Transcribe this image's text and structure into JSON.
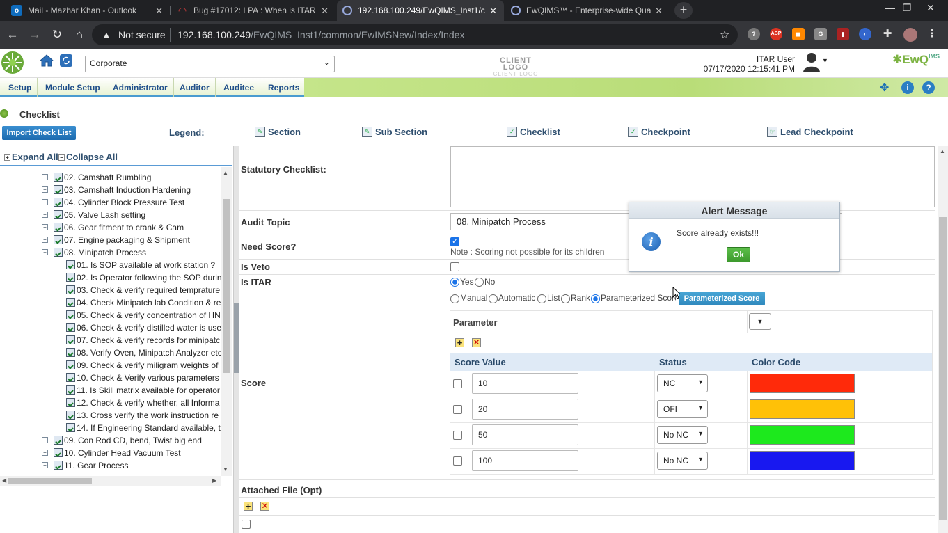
{
  "browser": {
    "tabs": [
      {
        "title": "Mail - Mazhar Khan - Outlook",
        "icon": "outlook-icon"
      },
      {
        "title": "Bug #17012: LPA : When is ITAR",
        "icon": "bug-tracker-icon"
      },
      {
        "title": "192.168.100.249/EwQIMS_Inst1/c",
        "icon": "globe-icon"
      },
      {
        "title": "EwQIMS™ - Enterprise-wide Qua",
        "icon": "globe-icon"
      }
    ],
    "not_secure": "Not secure",
    "url_host": "192.168.100.249",
    "url_path": "/EwQIMS_Inst1/common/EwIMSNew/Index/Index"
  },
  "header": {
    "entity_select": "Corporate",
    "client_logo": "CLIENT LOGO",
    "client_logo_sub": "CLIENT LOGO",
    "user_name": "ITAR User",
    "datetime": "07/17/2020 12:15:41 PM",
    "brand": "EwQ",
    "brand_sup": "IMS"
  },
  "menu": [
    "Setup",
    "Module Setup",
    "Administrator",
    "Auditor",
    "Auditee",
    "Reports"
  ],
  "breadcrumb": "Checklist",
  "legend": {
    "import_button": "Import Check List",
    "label": "Legend:",
    "items": [
      "Section",
      "Sub Section",
      "Checklist",
      "Checkpoint",
      "Lead Checkpoint"
    ]
  },
  "tree": {
    "expand_all": "Expand All",
    "collapse_all": "Collapse All",
    "items": [
      {
        "label": "02. Camshaft Rumbling",
        "level": 1,
        "exp": "+"
      },
      {
        "label": "03. Camshaft Induction Hardening",
        "level": 1,
        "exp": "+"
      },
      {
        "label": "04. Cylinder Block Pressure Test",
        "level": 1,
        "exp": "+"
      },
      {
        "label": "05. Valve Lash setting",
        "level": 1,
        "exp": "+"
      },
      {
        "label": "06. Gear fitment to crank & Cam",
        "level": 1,
        "exp": "+"
      },
      {
        "label": "07. Engine packaging & Shipment",
        "level": 1,
        "exp": "+"
      },
      {
        "label": "08. Minipatch Process",
        "level": 1,
        "exp": "-"
      },
      {
        "label": "01. Is SOP available at work station ?",
        "level": 2,
        "exp": ""
      },
      {
        "label": "02. Is Operator following the SOP durin",
        "level": 2,
        "exp": ""
      },
      {
        "label": "03. Check & verify required temprature",
        "level": 2,
        "exp": ""
      },
      {
        "label": "04. Check Minipatch lab Condition & re",
        "level": 2,
        "exp": ""
      },
      {
        "label": "05. Check & verify concentration of HN",
        "level": 2,
        "exp": ""
      },
      {
        "label": "06. Check & verify distilled water is use",
        "level": 2,
        "exp": ""
      },
      {
        "label": "07. Check & verify records for minipatc",
        "level": 2,
        "exp": ""
      },
      {
        "label": "08. Verify Oven, Minipatch Analyzer etc",
        "level": 2,
        "exp": ""
      },
      {
        "label": "09. Check & verify miligram weights of",
        "level": 2,
        "exp": ""
      },
      {
        "label": "10. Check & Verify various parameters",
        "level": 2,
        "exp": ""
      },
      {
        "label": "11. Is Skill matrix available for operator",
        "level": 2,
        "exp": ""
      },
      {
        "label": "12. Check & verify whether, all Informa",
        "level": 2,
        "exp": ""
      },
      {
        "label": "13. Cross verify the work instruction re",
        "level": 2,
        "exp": ""
      },
      {
        "label": "14. If Engineering Standard available, t",
        "level": 2,
        "exp": ""
      },
      {
        "label": "09. Con Rod CD, bend, Twist big end",
        "level": 1,
        "exp": "+"
      },
      {
        "label": "10. Cylinder Head Vacuum Test",
        "level": 1,
        "exp": "+"
      },
      {
        "label": "11. Gear Process",
        "level": 1,
        "exp": "+"
      }
    ]
  },
  "form": {
    "statutory_label": "Statutory Checklist:",
    "audit_topic_label": "Audit Topic",
    "audit_topic_value": "08. Minipatch Process",
    "need_score_label": "Need Score?",
    "need_score_checked": true,
    "score_note": "Note : Scoring not possible for its children",
    "is_veto_label": "Is Veto",
    "is_itar_label": "Is ITAR",
    "itar_yes": "Yes",
    "itar_no": "No",
    "score_label": "Score",
    "score_types": [
      "Manual",
      "Automatic",
      "List",
      "Rank",
      "Parameterized Score"
    ],
    "score_type_selected": "Parameterized Score",
    "param_score_button": "Parameterized Score",
    "parameter_header": "Parameter",
    "col_score_value": "Score Value",
    "col_status": "Status",
    "col_color": "Color Code",
    "rows": [
      {
        "value": "10",
        "status": "NC",
        "color": "#ff2a0a"
      },
      {
        "value": "20",
        "status": "OFI",
        "color": "#ffc107"
      },
      {
        "value": "50",
        "status": "No NC",
        "color": "#1de91d"
      },
      {
        "value": "100",
        "status": "No NC",
        "color": "#1818f0"
      }
    ],
    "attached_label": "Attached File (Opt)"
  },
  "alert": {
    "title": "Alert Message",
    "message": "Score already exists!!!",
    "ok": "Ok"
  }
}
